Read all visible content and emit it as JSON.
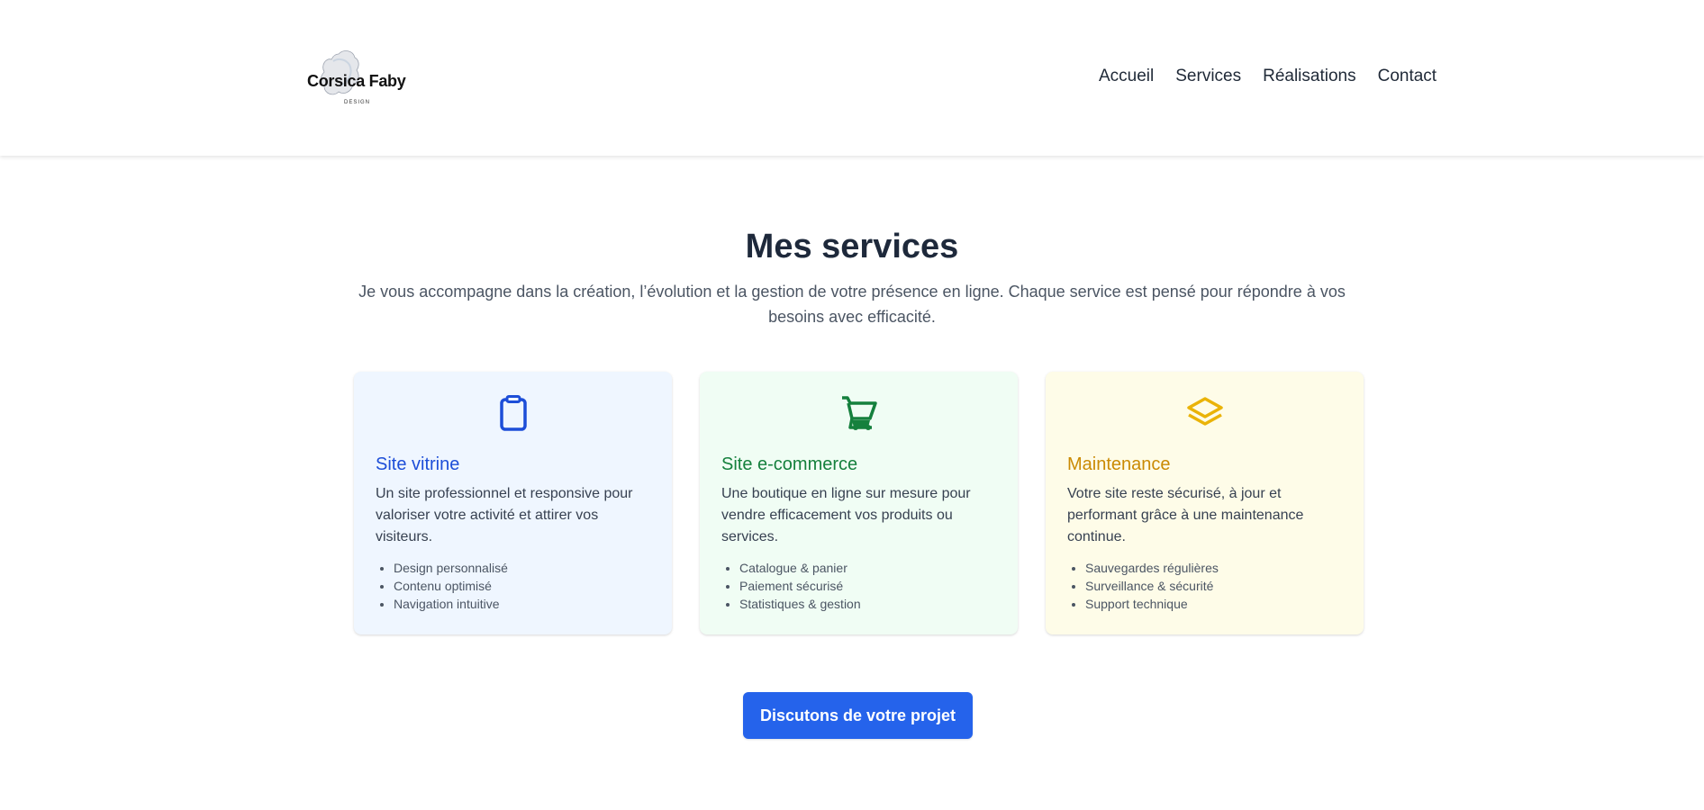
{
  "brand": {
    "name": "Corsica Faby",
    "tagline": "DESIGN",
    "logo_icon": "island-brush-logo"
  },
  "nav": {
    "items": [
      "Accueil",
      "Services",
      "Réalisations",
      "Contact"
    ]
  },
  "services": {
    "title": "Mes services",
    "intro": "Je vous accompagne dans la création, l’évolution et la gestion de votre présence en ligne. Chaque service est pensé pour répondre à vos besoins avec efficacité.",
    "cards": [
      {
        "icon": "clipboard-icon",
        "color": "#1d4ed8",
        "background": "#eff6ff",
        "title": "Site vitrine",
        "description": "Un site professionnel et responsive pour valoriser votre activité et attirer vos visiteurs.",
        "features": [
          "Design personnalisé",
          "Contenu optimisé",
          "Navigation intuitive"
        ]
      },
      {
        "icon": "shopping-cart-icon",
        "color": "#15803d",
        "background": "#f0fdf4",
        "title": "Site e-commerce",
        "description": "Une boutique en ligne sur mesure pour vendre efficacement vos produits ou services.",
        "features": [
          "Catalogue & panier",
          "Paiement sécurisé",
          "Statistiques & gestion"
        ]
      },
      {
        "icon": "layers-icon",
        "color": "#ca8a04",
        "background": "#fefce8",
        "title": "Maintenance",
        "description": "Votre site reste sécurisé, à jour et performant grâce à une maintenance continue.",
        "features": [
          "Sauvegardes régulières",
          "Surveillance & sécurité",
          "Support technique"
        ]
      }
    ],
    "cta_label": "Discutons de votre projet"
  },
  "colors": {
    "primary": "#2563eb",
    "heading": "#1e293b",
    "text": "#374151"
  }
}
